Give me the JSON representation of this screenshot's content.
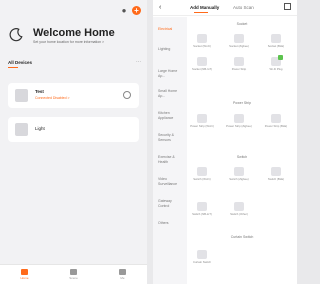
{
  "left": {
    "welcome_title": "Welcome Home",
    "welcome_subtitle": "Set your home location for more information >",
    "section_title": "All Devices",
    "more": "···",
    "devices": [
      {
        "name": "Test",
        "status": "Connected Disabled >"
      },
      {
        "name": "Light"
      }
    ],
    "tabs": [
      {
        "label": "Home",
        "icon": "home-icon",
        "active": true
      },
      {
        "label": "Scene",
        "icon": "scene-icon",
        "active": false
      },
      {
        "label": "Me",
        "icon": "me-icon",
        "active": false
      }
    ],
    "accent": "#ff6a1a"
  },
  "right": {
    "nav": {
      "back": "‹",
      "tab_manual": "Add Manually",
      "tab_auto": "Auto Scan"
    },
    "categories": [
      {
        "label": "Electrical",
        "active": true
      },
      {
        "label": "Lighting",
        "active": false
      },
      {
        "label": "Large Home Ap...",
        "active": false
      },
      {
        "label": "Small Home Ap...",
        "active": false
      },
      {
        "label": "Kitchen Appliance",
        "active": false
      },
      {
        "label": "Security & Sensors",
        "active": false
      },
      {
        "label": "Exercise & Health",
        "active": false
      },
      {
        "label": "Video Surveillance",
        "active": false
      },
      {
        "label": "Gateway Control",
        "active": false
      },
      {
        "label": "Others",
        "active": false
      }
    ],
    "groups": [
      {
        "title": "Socket",
        "items": [
          "Socket (Wi-Fi)",
          "Socket (Zigbee)",
          "Socket (BLE)",
          "Socket (NB-IoT)",
          "Power Strip",
          "Wi-Fi Plug"
        ]
      },
      {
        "title": "Power Strip",
        "items": [
          "Power Strip (Wi-Fi)",
          "Power Strip (Zigbee)",
          "Power Strip (BLE)"
        ]
      },
      {
        "title": "Switch",
        "items": [
          "Switch (Wi-Fi)",
          "Switch (Zigbee)",
          "Switch (BLE)",
          "Switch (NB-IoT)",
          "Switch (Other)"
        ]
      },
      {
        "title": "Curtain Switch",
        "items": [
          "Curtain Switch"
        ]
      }
    ]
  }
}
